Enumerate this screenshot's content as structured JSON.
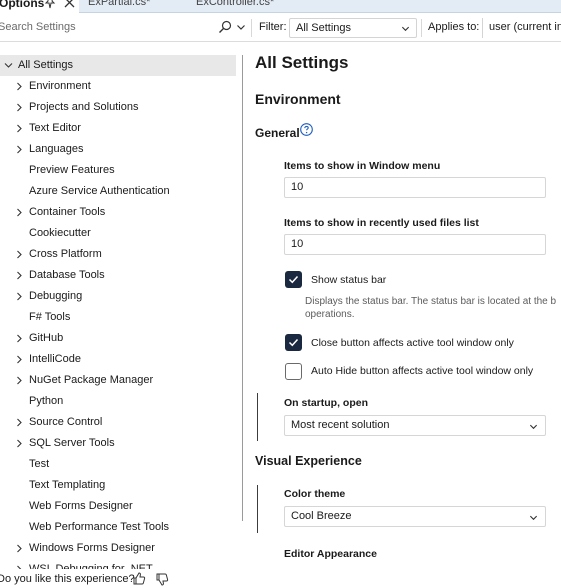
{
  "window": {
    "title": "Options",
    "doc_tabs": [
      "ExPartial.cs*",
      "ExController.cs*"
    ]
  },
  "toolbar": {
    "search_placeholder": "Search Settings",
    "filter_label": "Filter:",
    "filter_value": "All Settings",
    "applies_label": "Applies to:",
    "applies_value": "user (current ins"
  },
  "tree": {
    "items": [
      {
        "label": "All Settings",
        "expandable": true,
        "expanded": true,
        "selected": true
      },
      {
        "label": "Environment",
        "expandable": true
      },
      {
        "label": "Projects and Solutions",
        "expandable": true
      },
      {
        "label": "Text Editor",
        "expandable": true
      },
      {
        "label": "Languages",
        "expandable": true
      },
      {
        "label": "Preview Features",
        "expandable": false
      },
      {
        "label": "Azure Service Authentication",
        "expandable": false
      },
      {
        "label": "Container Tools",
        "expandable": true
      },
      {
        "label": "Cookiecutter",
        "expandable": false
      },
      {
        "label": "Cross Platform",
        "expandable": true
      },
      {
        "label": "Database Tools",
        "expandable": true
      },
      {
        "label": "Debugging",
        "expandable": true
      },
      {
        "label": "F# Tools",
        "expandable": false
      },
      {
        "label": "GitHub",
        "expandable": true
      },
      {
        "label": "IntelliCode",
        "expandable": true
      },
      {
        "label": "NuGet Package Manager",
        "expandable": true
      },
      {
        "label": "Python",
        "expandable": false
      },
      {
        "label": "Source Control",
        "expandable": true
      },
      {
        "label": "SQL Server Tools",
        "expandable": true
      },
      {
        "label": "Test",
        "expandable": false
      },
      {
        "label": "Text Templating",
        "expandable": false
      },
      {
        "label": "Web Forms Designer",
        "expandable": false
      },
      {
        "label": "Web Performance Test Tools",
        "expandable": false
      },
      {
        "label": "Windows Forms Designer",
        "expandable": true
      },
      {
        "label": "WSL Debugging for .NET",
        "expandable": true
      }
    ]
  },
  "feedback": {
    "question": "Do you like this experience?"
  },
  "content": {
    "page_title": "All Settings",
    "environment": {
      "title": "Environment",
      "general_title": "General",
      "window_menu": {
        "label": "Items to show in Window menu",
        "value": "10"
      },
      "recent_files": {
        "label": "Items to show in recently used files list",
        "value": "10"
      },
      "status_bar": {
        "label": "Show status bar",
        "checked": true,
        "desc_line1": "Displays the status bar. The status bar is located at the b",
        "desc_line2": "operations."
      },
      "close_button": {
        "label": "Close button affects active tool window only",
        "checked": true
      },
      "autohide_button": {
        "label": "Auto Hide button affects active tool window only",
        "checked": false
      },
      "startup": {
        "label": "On startup, open",
        "value": "Most recent solution"
      }
    },
    "visual": {
      "title": "Visual Experience",
      "color_theme": {
        "label": "Color theme",
        "value": "Cool Breeze"
      },
      "editor_appearance_label": "Editor Appearance"
    }
  },
  "colors": {
    "checkbox_checked": "#1b2940",
    "selected_row": "#e8e8e8",
    "help_icon": "#1f5fbf",
    "tab_strip": "#e3ebf5"
  }
}
